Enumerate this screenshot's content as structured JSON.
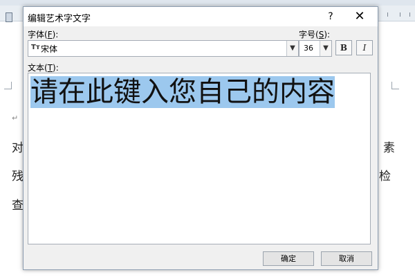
{
  "dialog": {
    "title": "编辑艺术字文字",
    "help_label": "?",
    "close_label": "✕",
    "font_label": "字体",
    "font_hotkey": "F",
    "font_value": "宋体",
    "font_type_glyph": "Tт",
    "size_label": "字号",
    "size_hotkey": "S",
    "size_value": "36",
    "bold_label": "B",
    "italic_label": "I",
    "text_label": "文本",
    "text_hotkey": "T",
    "text_value": "请在此键入您自己的内容",
    "ok_label": "确定",
    "cancel_label": "取消"
  },
  "document": {
    "left_chars": [
      "对",
      "残",
      "查"
    ],
    "right_chars": [
      "素",
      "检"
    ],
    "right_partial": "素",
    "return_mark": "↵"
  },
  "icons": {
    "dropdown": "chevron-down-icon",
    "font_type": "truetype-font-icon",
    "close": "close-icon",
    "help": "help-icon"
  },
  "colors": {
    "selection": "#9cc8ee",
    "dialog_bg": "#f0f0f0",
    "border": "#8c9db0"
  }
}
